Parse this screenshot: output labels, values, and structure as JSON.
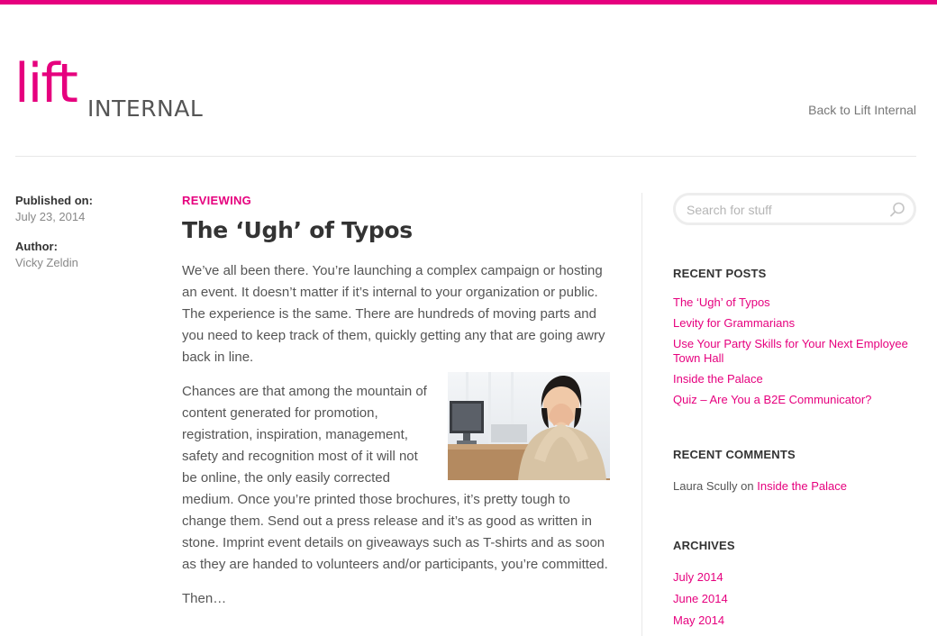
{
  "brand": {
    "logo_lift": "lift",
    "logo_internal": "INTERNAL",
    "accent_color": "#e6007e"
  },
  "header": {
    "back_link": "Back to Lift Internal"
  },
  "meta": {
    "published_label": "Published on:",
    "published_value": "July 23, 2014",
    "author_label": "Author:",
    "author_value": "Vicky Zeldin"
  },
  "article": {
    "category": "REVIEWING",
    "title": "The ‘Ugh’ of Typos",
    "paragraphs": [
      "We’ve all been there.  You’re launching a complex campaign or hosting an event.  It doesn’t matter if it’s internal to your organization or public.  The experience is the same.  There are hundreds of moving parts and you need to keep track of them, quickly getting any that are going awry back in line.",
      "Chances are that among the mountain of content generated for promotion, registration, inspiration, management, safety and recognition most of it will not be online, the only easily corrected medium.  Once you’re printed those brochures, it’s pretty tough to change them.  Send out a press release and it’s as good as written in stone.  Imprint event details on giveaways such as T-shirts and as soon as they are handed to volunteers and/or participants, you’re committed.",
      "Then…"
    ]
  },
  "sidebar": {
    "search_placeholder": "Search for stuff",
    "recent_posts_title": "RECENT POSTS",
    "recent_posts": [
      "The ‘Ugh’ of Typos",
      "Levity for Grammarians",
      "Use Your Party Skills for Your Next Employee Town Hall",
      "Inside the Palace",
      "Quiz – Are You a B2E Communicator?"
    ],
    "recent_comments_title": "RECENT COMMENTS",
    "recent_comment": {
      "author": "Laura Scully",
      "on": "on",
      "post": "Inside the Palace"
    },
    "archives_title": "ARCHIVES",
    "archives": [
      "July 2014",
      "June 2014",
      "May 2014"
    ]
  },
  "icons": {
    "search": "search-icon"
  }
}
